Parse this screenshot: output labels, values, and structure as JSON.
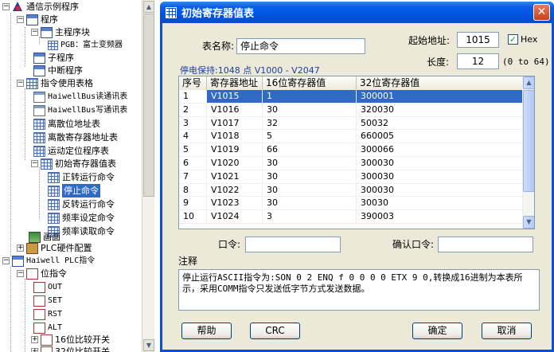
{
  "tree": {
    "root": "通信示例程序",
    "program": "程序",
    "main_block": "主程序块",
    "main_sub": "PGB：富士变频器",
    "subroutine": "子程序",
    "interrupt": "中断程序",
    "instr_tables": "指令使用表格",
    "table_items": [
      "HaiwellBus读通讯表",
      "HaiwellBus写通讯表",
      "离散位地址表",
      "离散寄存器地址表",
      "运动定位程序表",
      "初始寄存器值表"
    ],
    "reg_children": [
      "正转运行命令",
      "停止命令",
      "反转运行命令",
      "频率设定命令",
      "频率读取命令"
    ],
    "screen": "画面",
    "plc_hw": "PLC硬件配置",
    "plc_instr": "Haiwell PLC指令",
    "bit_instr": "位指令",
    "bit_items": [
      "OUT",
      "SET",
      "RST",
      "ALT"
    ],
    "cmp16": "16位比较开关",
    "cmp32": "32位比较开关"
  },
  "dialog": {
    "title": "初始寄存器值表",
    "close_icon": "close-icon",
    "name_label": "表名称:",
    "name_value": "停止命令",
    "start_label": "起始地址:",
    "start_value": "1015",
    "hex_label": "Hex",
    "hex_checked": true,
    "length_label": "长度:",
    "length_value": "12",
    "length_range": "(0 to 64)",
    "retain_info": "停电保持:1048 点 V1000 - V2047",
    "columns": [
      "序号",
      "寄存器地址",
      "16位寄存器值",
      "32位寄存器值"
    ],
    "rows": [
      [
        "1",
        "V1015",
        "1",
        "300001"
      ],
      [
        "2",
        "V1016",
        "30",
        "320030"
      ],
      [
        "3",
        "V1017",
        "32",
        "50032"
      ],
      [
        "4",
        "V1018",
        "5",
        "660005"
      ],
      [
        "5",
        "V1019",
        "66",
        "300066"
      ],
      [
        "6",
        "V1020",
        "30",
        "300030"
      ],
      [
        "7",
        "V1021",
        "30",
        "300030"
      ],
      [
        "8",
        "V1022",
        "30",
        "300030"
      ],
      [
        "9",
        "V1023",
        "30",
        "30030"
      ],
      [
        "10",
        "V1024",
        "3",
        "390003"
      ]
    ],
    "selected_row": 0,
    "password_label": "口令:",
    "password_value": "",
    "confirm_label": "确认口令:",
    "confirm_value": "",
    "notes_label": "注释",
    "notes_text": "停止运行ASCII指令为:SON 0 2 ENQ f 0 0 0 0 ETX 9 0,转换成16进制为本表所示，采用COMM指令只发送低字节方式发送数据。",
    "help": "帮助",
    "crc": "CRC",
    "ok": "确定",
    "cancel": "取消"
  },
  "colors": {
    "title_blue": "#0054e3",
    "select_blue": "#316ac5",
    "info_blue": "#1b3fa6"
  }
}
